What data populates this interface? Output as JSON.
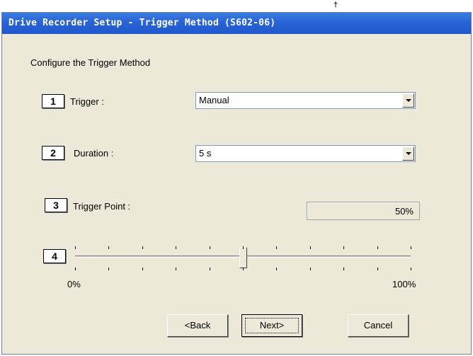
{
  "window": {
    "title": "Drive Recorder Setup - Trigger Method (S602-06)",
    "corner_mark": "†"
  },
  "heading": "Configure the Trigger Method",
  "steps": {
    "trigger": {
      "number": "1",
      "label": "Trigger :",
      "selected": "Manual"
    },
    "duration": {
      "number": "2",
      "label": "Duration :",
      "selected": "5 s"
    },
    "trigger_point": {
      "number": "3",
      "label": "Trigger Point :",
      "readout": "50%"
    },
    "slider": {
      "number": "4",
      "value_percent": 50,
      "min_label": "0%",
      "max_label": "100%",
      "tick_count": 11
    }
  },
  "buttons": {
    "back": "<Back",
    "next": "Next>",
    "cancel": "Cancel"
  },
  "colors": {
    "titlebar": "#2863d6",
    "dialog_bg": "#ece9d8"
  },
  "icons": {
    "combo_arrow": "chevron-down-icon"
  }
}
